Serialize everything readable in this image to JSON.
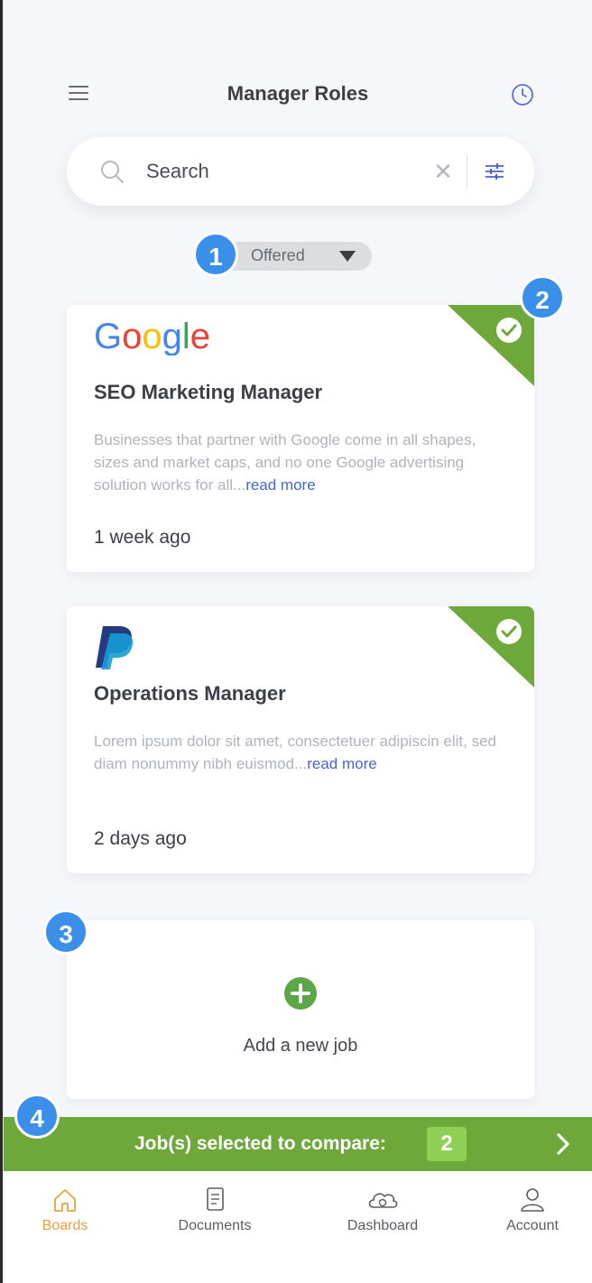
{
  "header": {
    "title": "Manager Roles",
    "menu_icon": "hamburger-menu-icon",
    "history_icon": "clock-history-icon",
    "accent_color": "#5b6fd8"
  },
  "search": {
    "placeholder": "Search",
    "clear_icon": "close-icon",
    "filter_icon": "sliders-filter-icon"
  },
  "filter": {
    "selected": "Offered",
    "caret_icon": "caret-down-icon"
  },
  "annotations": [
    "1",
    "2",
    "3",
    "4"
  ],
  "jobs": [
    {
      "company": "Google",
      "title": "SEO Marketing Manager",
      "description": "Businesses that partner with Google come in all shapes, sizes and market caps, and no one Google advertising solution works for all...",
      "read_more": "read more",
      "posted": "1 week ago",
      "selected": true
    },
    {
      "company": "PayPal",
      "title": "Operations Manager",
      "description": "Lorem ipsum dolor sit amet, consectetuer adipiscin elit, sed diam nonummy nibh euismod...",
      "read_more": "read more",
      "posted": "2 days ago",
      "selected": true
    }
  ],
  "add_job": {
    "label": "Add a new job",
    "icon": "plus-circle-icon"
  },
  "compare_bar": {
    "label": "Job(s) selected to compare:",
    "count": "2",
    "color": "#6fa83a"
  },
  "tabs": [
    {
      "label": "Boards",
      "icon": "home-icon",
      "active": true
    },
    {
      "label": "Documents",
      "icon": "document-icon",
      "active": false
    },
    {
      "label": "Dashboard",
      "icon": "cloud-dashboard-icon",
      "active": false
    },
    {
      "label": "Account",
      "icon": "user-icon",
      "active": false
    }
  ],
  "colors": {
    "selected_corner": "#6fa83a",
    "badge_blue": "#3a8fe8",
    "active_tab": "#e9a23b"
  }
}
